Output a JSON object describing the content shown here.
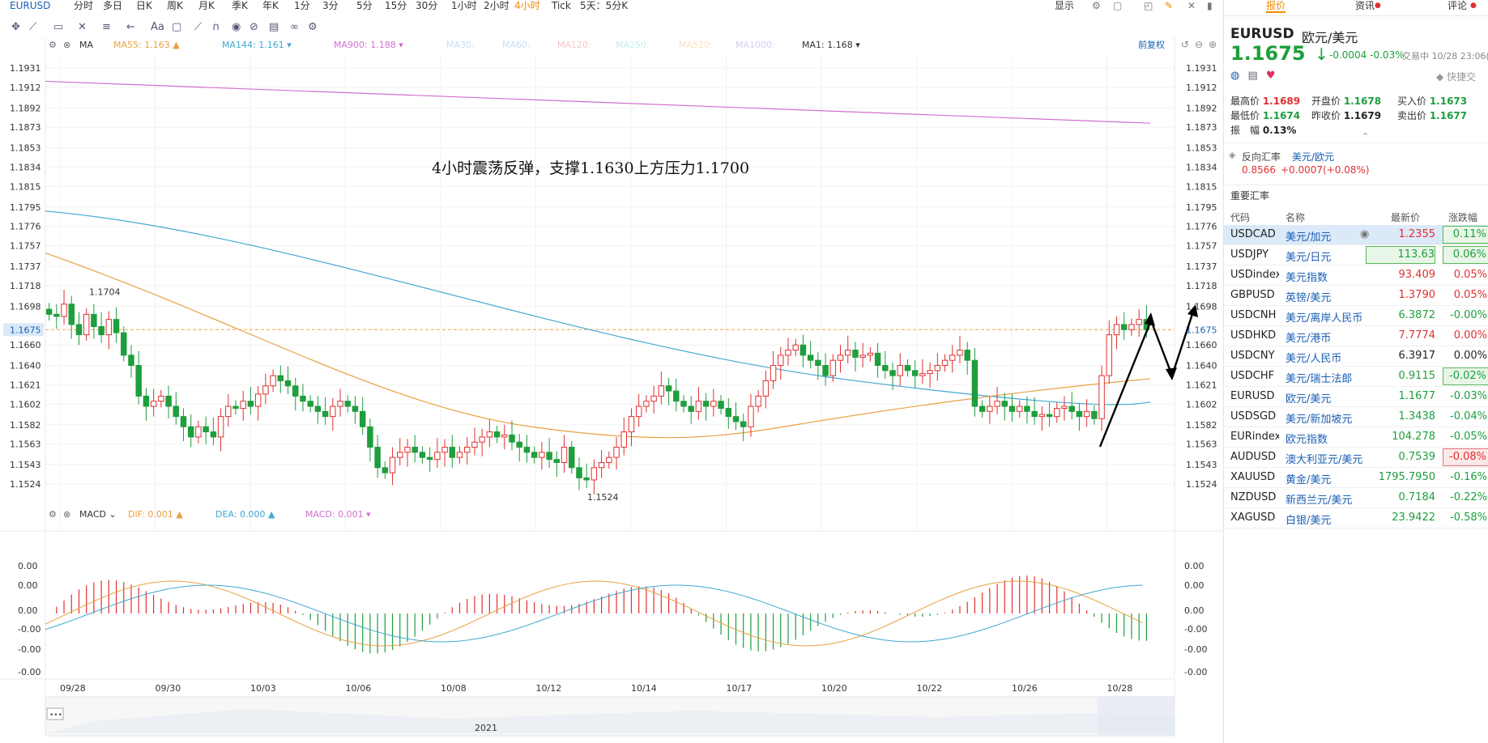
{
  "timeframes": [
    "EURUSD",
    "分时",
    "多日",
    "日K",
    "周K",
    "月K",
    "季K",
    "年K",
    "1分",
    "3分",
    "5分",
    "15分",
    "30分",
    "1小时",
    "2小时",
    "4小时",
    "Tick",
    "5天：5分K"
  ],
  "active_timeframe": "4小时",
  "display_label": "显示",
  "ma_legend": {
    "ma": "MA",
    "ma55": "MA55: 1.163",
    "ma144": "MA144: 1.161",
    "ma900": "MA900: 1.188",
    "ma30": "MA30:",
    "ma60": "MA60:",
    "ma120": "MA120:",
    "ma250": "MA250:",
    "ma520": "MA520:",
    "ma1000": "MA1000:",
    "ma1": "MA1: 1.168",
    "restore": "前复权"
  },
  "annotation": "4小时震荡反弹，支撑1.1630上方压力1.1700",
  "price_ticks": [
    "1.1931",
    "1.1912",
    "1.1892",
    "1.1873",
    "1.1853",
    "1.1834",
    "1.1815",
    "1.1795",
    "1.1776",
    "1.1757",
    "1.1737",
    "1.1718",
    "1.1698",
    "1.1675",
    "1.1660",
    "1.1640",
    "1.1621",
    "1.1602",
    "1.1582",
    "1.1563",
    "1.1543",
    "1.1524"
  ],
  "current_price_label": "1.1675",
  "high_label": "1.1704",
  "low_label": "1.1524",
  "macd_legend": {
    "macd": "MACD",
    "dif": "DIF: 0.001",
    "dea": "DEA: 0.000",
    "macdv": "MACD: 0.001"
  },
  "macd_ticks": [
    "0.00",
    "0.00",
    "0.00",
    "-0.00",
    "-0.00",
    "-0.00"
  ],
  "date_labels": [
    "09/28",
    "09/30",
    "10/03",
    "10/06",
    "10/08",
    "10/12",
    "10/14",
    "10/17",
    "10/20",
    "10/22",
    "10/26",
    "10/28"
  ],
  "year_label": "2021",
  "nav_dots": "•••",
  "panel": {
    "tabs": [
      "报价",
      "资讯",
      "评论"
    ],
    "symbol": "EURUSD",
    "name": "欧元/美元",
    "price": "1.1675",
    "change": "-0.0004",
    "change_pct": "-0.03%",
    "status": "交易中 10/28 23:06(北",
    "quick_label": "快捷交",
    "stats": [
      {
        "label": "最高价",
        "value": "1.1689",
        "color": "#e03030"
      },
      {
        "label": "开盘价",
        "value": "1.1678",
        "color": "#1e9e3c"
      },
      {
        "label": "买入价",
        "value": "1.1673",
        "color": "#1e9e3c"
      },
      {
        "label": "最低价",
        "value": "1.1674",
        "color": "#1e9e3c"
      },
      {
        "label": "昨收价",
        "value": "1.1679",
        "color": "#222"
      },
      {
        "label": "卖出价",
        "value": "1.1677",
        "color": "#1e9e3c"
      },
      {
        "label": "振　幅",
        "value": "0.13%",
        "color": "#222"
      }
    ],
    "reverse_label": "反向汇率",
    "reverse_pair": "美元/欧元",
    "reverse_price": "0.8566",
    "reverse_change": "+0.0007(+0.08%)",
    "section_title": "重要汇率",
    "headers": [
      "代码",
      "名称",
      "最新价",
      "涨跌幅"
    ],
    "rows": [
      {
        "code": "USDCAD",
        "name": "美元/加元",
        "price": "1.2355",
        "change": "0.11%",
        "pc": "red",
        "cc": "green"
      },
      {
        "code": "USDJPY",
        "name": "美元/日元",
        "price": "113.63",
        "change": "0.06%",
        "pc": "green",
        "cc": "green"
      },
      {
        "code": "USDindex",
        "name": "美元指数",
        "price": "93.409",
        "change": "0.05%",
        "pc": "red",
        "cc": "red"
      },
      {
        "code": "GBPUSD",
        "name": "英镑/美元",
        "price": "1.3790",
        "change": "0.05%",
        "pc": "red",
        "cc": "red"
      },
      {
        "code": "USDCNH",
        "name": "美元/离岸人民币",
        "price": "6.3872",
        "change": "-0.00%",
        "pc": "green",
        "cc": "green"
      },
      {
        "code": "USDHKD",
        "name": "美元/港币",
        "price": "7.7774",
        "change": "0.00%",
        "pc": "red",
        "cc": "red"
      },
      {
        "code": "USDCNY",
        "name": "美元/人民币",
        "price": "6.3917",
        "change": "0.00%",
        "pc": "black",
        "cc": "black"
      },
      {
        "code": "USDCHF",
        "name": "美元/瑞士法郎",
        "price": "0.9115",
        "change": "-0.02%",
        "pc": "green",
        "cc": "green"
      },
      {
        "code": "EURUSD",
        "name": "欧元/美元",
        "price": "1.1677",
        "change": "-0.03%",
        "pc": "green",
        "cc": "green"
      },
      {
        "code": "USDSGD",
        "name": "美元/新加坡元",
        "price": "1.3438",
        "change": "-0.04%",
        "pc": "green",
        "cc": "green"
      },
      {
        "code": "EURindex",
        "name": "欧元指数",
        "price": "104.278",
        "change": "-0.05%",
        "pc": "green",
        "cc": "green"
      },
      {
        "code": "AUDUSD",
        "name": "澳大利亚元/美元",
        "price": "0.7539",
        "change": "-0.08%",
        "pc": "green",
        "cc": "red"
      },
      {
        "code": "XAUUSD",
        "name": "黄金/美元",
        "price": "1795.7950",
        "change": "-0.16%",
        "pc": "green",
        "cc": "green"
      },
      {
        "code": "NZDUSD",
        "name": "新西兰元/美元",
        "price": "0.7184",
        "change": "-0.22%",
        "pc": "green",
        "cc": "green"
      },
      {
        "code": "XAGUSD",
        "name": "白银/美元",
        "price": "23.9422",
        "change": "-0.58%",
        "pc": "green",
        "cc": "green"
      }
    ]
  },
  "colors": {
    "up": "#e03030",
    "down": "#1e9e3c",
    "ma55": "#e8a040",
    "ma144": "#40a8d0",
    "ma900": "#d070d0",
    "accent": "#f08c00"
  },
  "chart_data": {
    "type": "candlestick",
    "candles": [
      1.169,
      1.1688,
      1.17,
      1.168,
      1.167,
      1.169,
      1.1678,
      1.167,
      1.1685,
      1.1672,
      1.165,
      1.164,
      1.161,
      1.16,
      1.1605,
      1.161,
      1.16,
      1.159,
      1.158,
      1.157,
      1.158,
      1.1575,
      1.157,
      1.159,
      1.16,
      1.1598,
      1.1605,
      1.16,
      1.1612,
      1.162,
      1.163,
      1.1625,
      1.162,
      1.161,
      1.1605,
      1.16,
      1.1595,
      1.159,
      1.16,
      1.1605,
      1.16,
      1.1595,
      1.158,
      1.156,
      1.154,
      1.1535,
      1.155,
      1.1555,
      1.156,
      1.1555,
      1.155,
      1.1548,
      1.1555,
      1.156,
      1.155,
      1.1555,
      1.156,
      1.1565,
      1.157,
      1.1575,
      1.157,
      1.1572,
      1.1565,
      1.156,
      1.1555,
      1.155,
      1.1555,
      1.1548,
      1.1545,
      1.156,
      1.154,
      1.153,
      1.1528,
      1.154,
      1.1545,
      1.155,
      1.156,
      1.1575,
      1.159,
      1.16,
      1.1605,
      1.161,
      1.162,
      1.1615,
      1.1605,
      1.16,
      1.1595,
      1.1605,
      1.16,
      1.1605,
      1.1598,
      1.159,
      1.1585,
      1.158,
      1.16,
      1.161,
      1.1625,
      1.164,
      1.165,
      1.1655,
      1.166,
      1.165,
      1.1645,
      1.164,
      1.163,
      1.1645,
      1.165,
      1.1655,
      1.1648,
      1.165,
      1.1652,
      1.164,
      1.1635,
      1.163,
      1.164,
      1.1635,
      1.163,
      1.1632,
      1.1635,
      1.164,
      1.1645,
      1.165,
      1.1655,
      1.1645,
      1.16,
      1.1595,
      1.16,
      1.1605,
      1.16,
      1.1595,
      1.16,
      1.1595,
      1.159,
      1.1592,
      1.159,
      1.1598,
      1.16,
      1.1595,
      1.159,
      1.1595,
      1.1588,
      1.163,
      1.167,
      1.168,
      1.1675,
      1.168,
      1.1685,
      1.1675
    ]
  }
}
